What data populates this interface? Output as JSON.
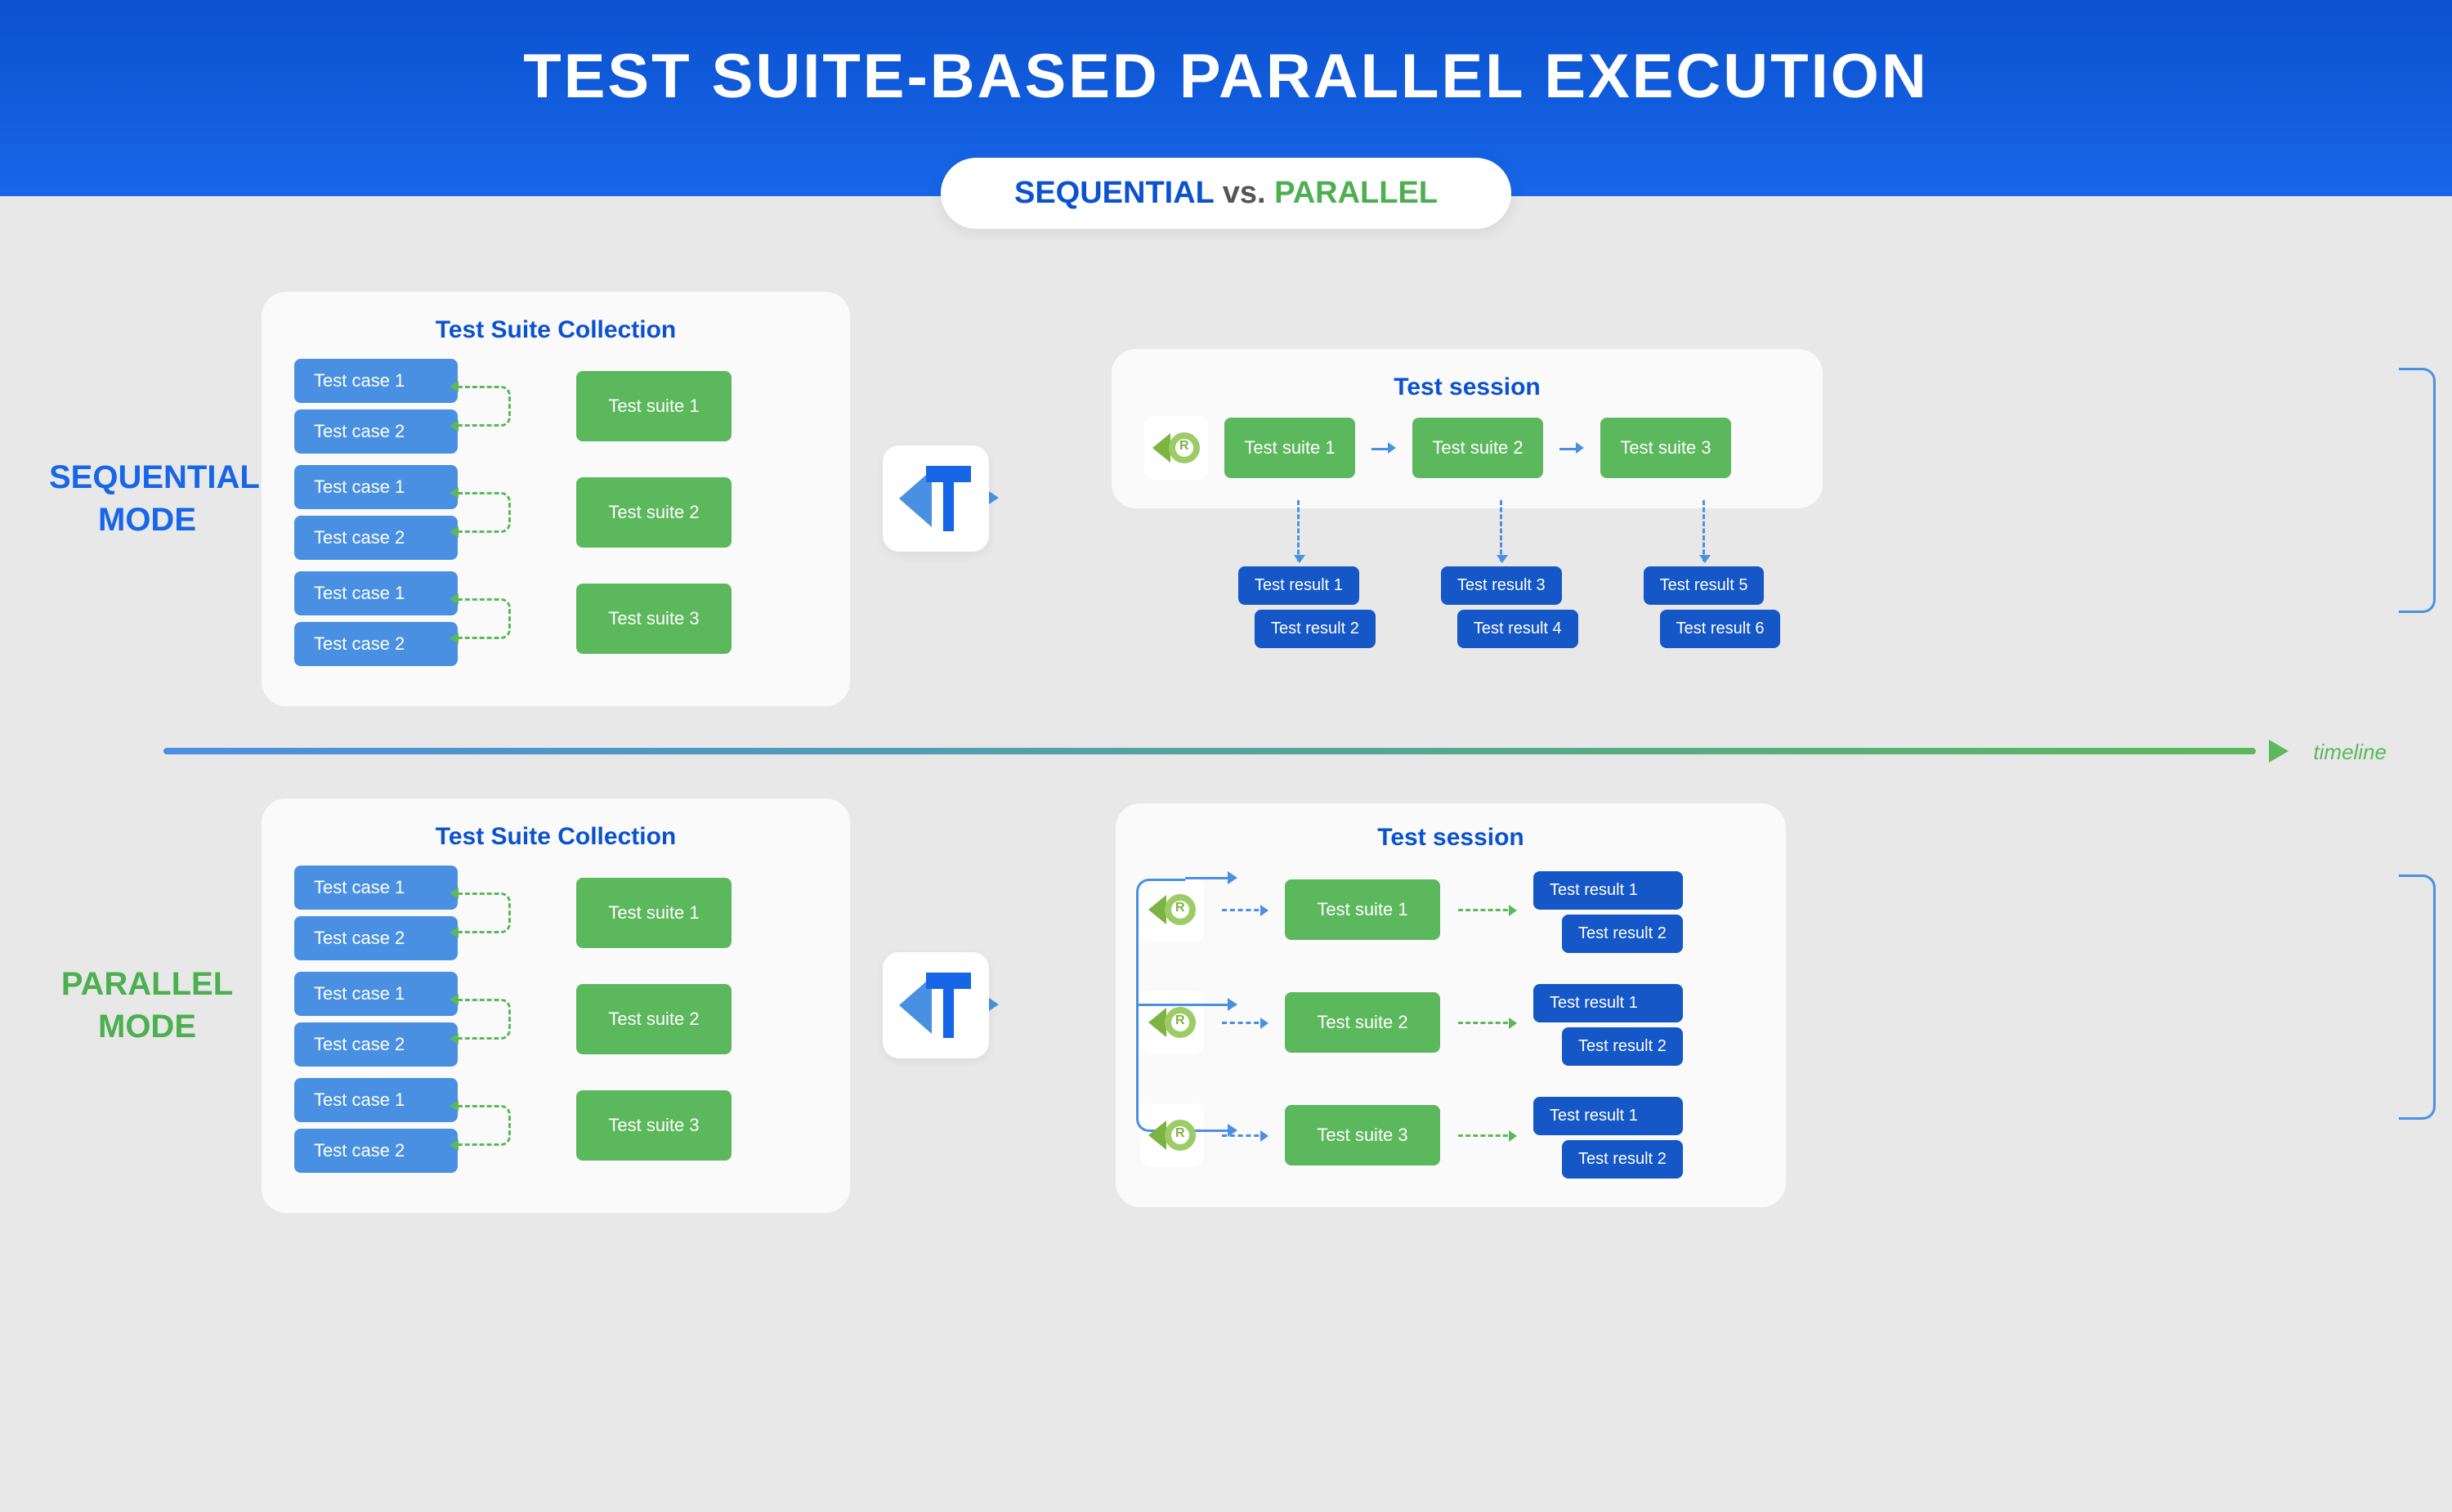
{
  "header": {
    "title": "TEST SUITE-BASED PARALLEL EXECUTION"
  },
  "pill": {
    "seq": "SEQUENTIAL",
    "vs": "vs.",
    "par": "PARALLEL"
  },
  "modes": {
    "sequential": "SEQUENTIAL MODE",
    "parallel": "PARALLEL MODE"
  },
  "collection": {
    "title": "Test Suite Collection",
    "groups": [
      {
        "cases": [
          "Test case 1",
          "Test case 2"
        ],
        "suite": "Test suite 1"
      },
      {
        "cases": [
          "Test case 1",
          "Test case 2"
        ],
        "suite": "Test suite 2"
      },
      {
        "cases": [
          "Test case 1",
          "Test case 2"
        ],
        "suite": "Test suite 3"
      }
    ]
  },
  "session": {
    "title": "Test session",
    "seq_suites": [
      "Test suite 1",
      "Test suite 2",
      "Test suite 3"
    ],
    "seq_results": [
      [
        "Test result 1",
        "Test result 2"
      ],
      [
        "Test result 3",
        "Test result 4"
      ],
      [
        "Test result 5",
        "Test result 6"
      ]
    ],
    "par_rows": [
      {
        "suite": "Test suite 1",
        "results": [
          "Test result 1",
          "Test result 2"
        ]
      },
      {
        "suite": "Test suite 2",
        "results": [
          "Test result 1",
          "Test result 2"
        ]
      },
      {
        "suite": "Test suite 3",
        "results": [
          "Test result 1",
          "Test result 2"
        ]
      }
    ]
  },
  "timeline_label": "timeline",
  "colors": {
    "blue": "#1866e8",
    "lblue": "#4a90e2",
    "green": "#5cb85c",
    "dblue": "#1557c7"
  }
}
